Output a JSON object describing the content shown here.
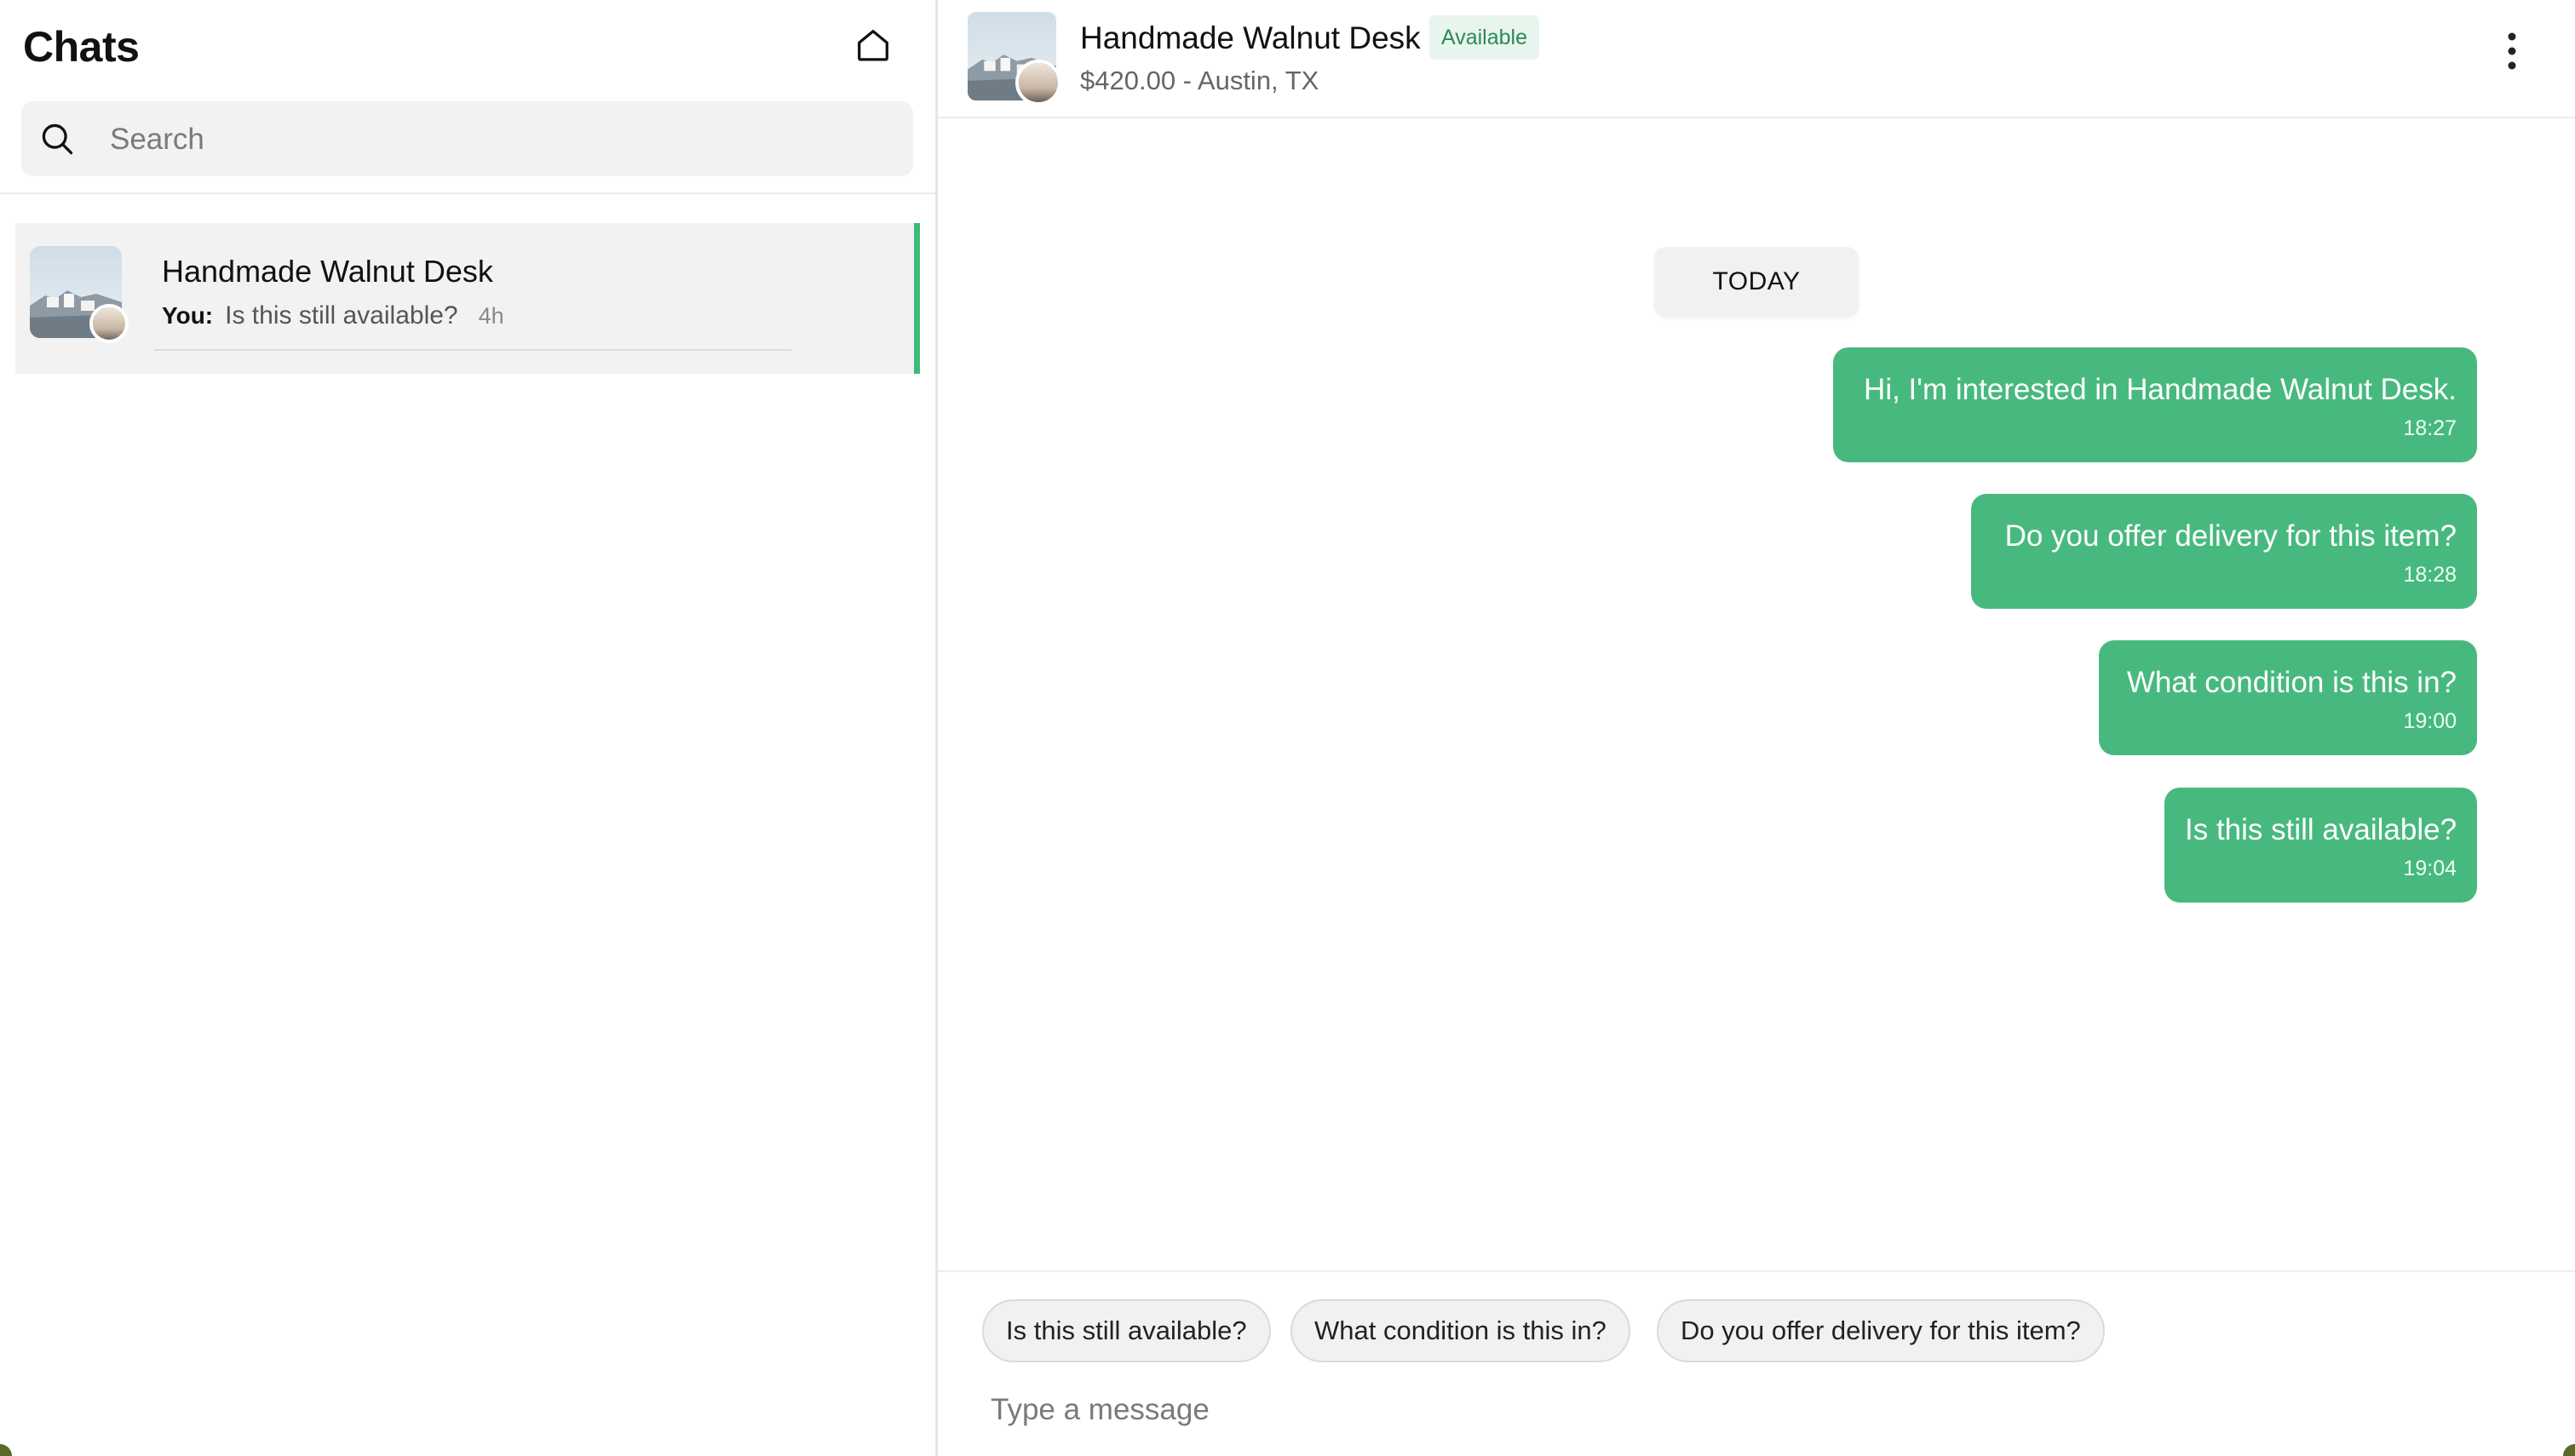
{
  "sidebar": {
    "title": "Chats",
    "home_icon": "home-icon",
    "search": {
      "placeholder": "Search",
      "icon": "search-icon"
    },
    "chats": [
      {
        "name": "Handmade Walnut Desk",
        "sender": "You:",
        "preview": "Is this still available?",
        "time": "4h",
        "active": true
      }
    ]
  },
  "conversation": {
    "title": "Handmade Walnut Desk",
    "status": "Available",
    "subtitle": "$420.00 - Austin, TX",
    "menu_icon": "more-vertical-icon",
    "date_divider": "TODAY",
    "messages": [
      {
        "text": "Hi, I'm interested in Handmade Walnut Desk.",
        "time": "18:27",
        "outgoing": true
      },
      {
        "text": "Do you offer delivery for this item?",
        "time": "18:28",
        "outgoing": true
      },
      {
        "text": "What condition is this in?",
        "time": "19:00",
        "outgoing": true
      },
      {
        "text": "Is this still available?",
        "time": "19:04",
        "outgoing": true
      }
    ],
    "quick_replies": [
      "Is this still available?",
      "What condition is this in?",
      "Do you offer delivery for this item?"
    ],
    "composer": {
      "placeholder": "Type a message"
    }
  },
  "colors": {
    "accent": "#48b97e",
    "active_bar": "#3fb97a",
    "badge_bg": "#e8f5ee",
    "badge_text": "#2c8a55"
  }
}
